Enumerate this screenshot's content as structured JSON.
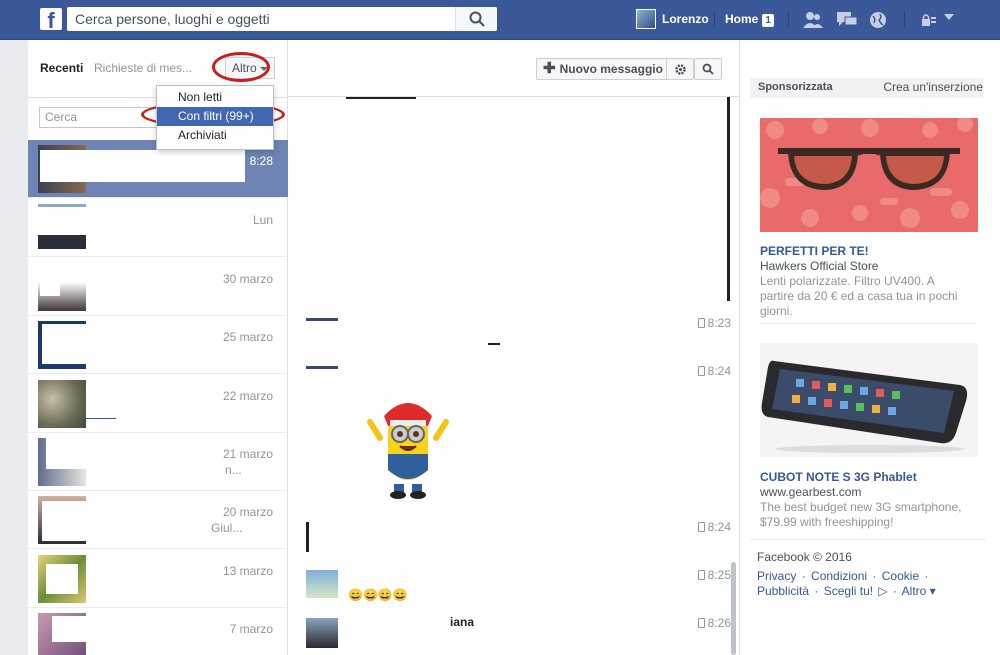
{
  "topbar": {
    "logo": "f",
    "search_placeholder": "Cerca persone, luoghi e oggetti",
    "user_name": "Lorenzo",
    "home_label": "Home",
    "home_count": "1"
  },
  "left": {
    "tab_recent": "Recenti",
    "tab_requests": "Richieste di mes...",
    "more_label": "Altro",
    "find_placeholder": "Cerca",
    "dropdown": [
      "Non letti",
      "Con filtri (99+)",
      "Archiviati"
    ],
    "conversations": [
      {
        "time": "8:28",
        "snippet": ""
      },
      {
        "time": "Lun",
        "snippet": ""
      },
      {
        "time": "30 marzo",
        "snippet": ""
      },
      {
        "time": "25 marzo",
        "snippet": ""
      },
      {
        "time": "22 marzo",
        "snippet": ""
      },
      {
        "time": "21 marzo",
        "snippet": "n..."
      },
      {
        "time": "20 marzo",
        "snippet": "Giul..."
      },
      {
        "time": "13 marzo",
        "snippet": ""
      },
      {
        "time": "7 marzo",
        "snippet": ""
      }
    ]
  },
  "center": {
    "new_message": "Nuovo messaggio",
    "times": [
      "8:23",
      "8:24",
      "8:24",
      "8:25",
      "8:26"
    ],
    "emojis": "😄😄😄😄",
    "last_name_fragment": "iana"
  },
  "right": {
    "sponsored": "Sponsorizzata",
    "create_ad": "Crea un'inserzione",
    "ads": [
      {
        "title": "PERFETTI PER TE!",
        "source": "Hawkers Official Store",
        "text": "Lenti polarizzate. Filtro UV400. A partire da 20 € ed a casa tua in pochi giorni."
      },
      {
        "title": "CUBOT NOTE S 3G Phablet",
        "source": "www.gearbest.com",
        "text": "The best budget new 3G smartphone, $79.99 with freeshipping!"
      }
    ],
    "copyright": "Facebook © 2016",
    "links": [
      "Privacy",
      "·",
      "Condizioni",
      "·",
      "Cookie",
      "·",
      "Pubblicità",
      "·",
      "Scegli tu!",
      "▷",
      "·",
      "Altro ▾"
    ]
  },
  "colors": {
    "brand": "#3b5998",
    "highlight": "#6d84b4",
    "annotation": "#cc1b1b"
  }
}
